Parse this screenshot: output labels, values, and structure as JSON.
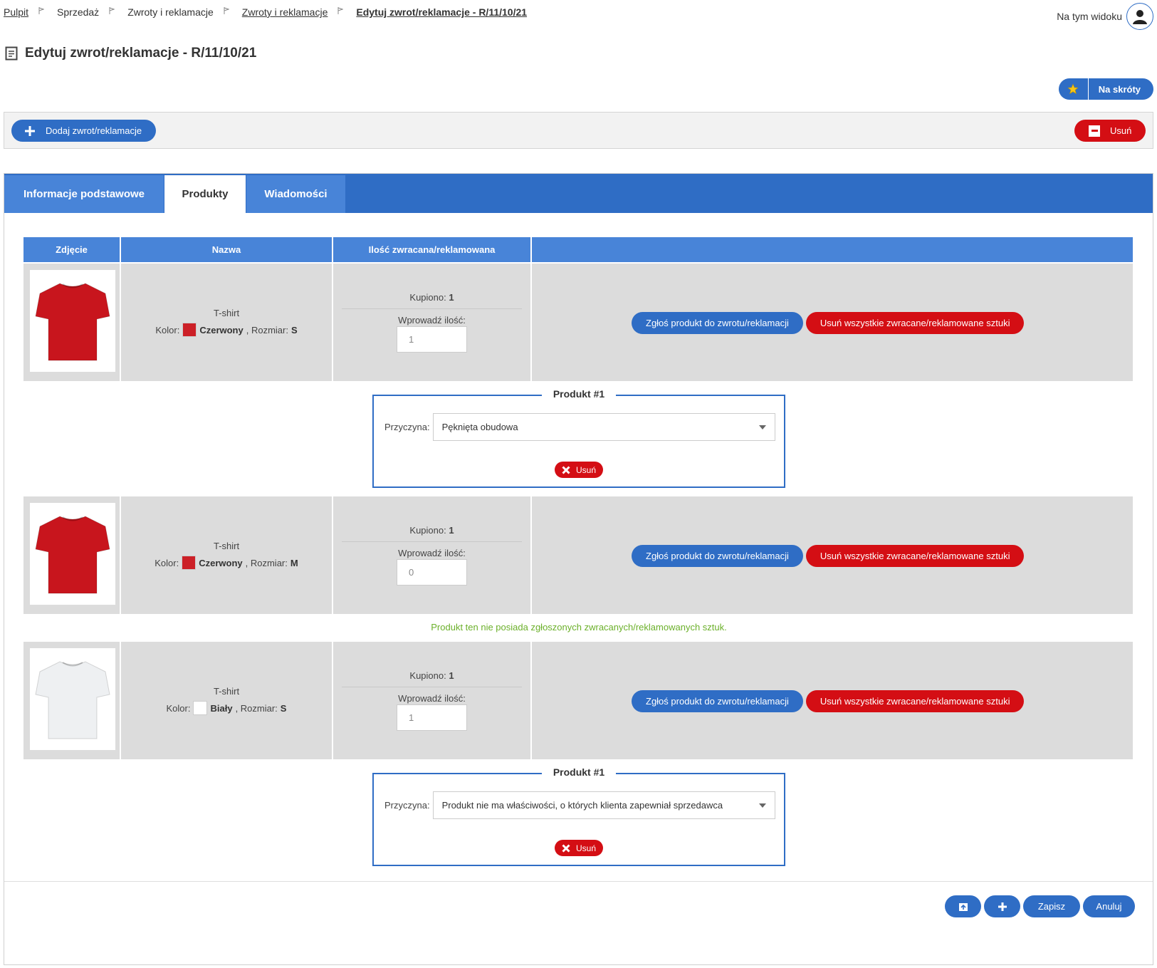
{
  "breadcrumb": {
    "items": [
      {
        "label": "Pulpit",
        "style": "link"
      },
      {
        "label": "Sprzedaż",
        "style": "plain"
      },
      {
        "label": "Zwroty i reklamacje",
        "style": "plain"
      },
      {
        "label": "Zwroty i reklamacje",
        "style": "link"
      },
      {
        "label": "Edytuj zwrot/reklamacje - R/11/10/21",
        "style": "current"
      }
    ]
  },
  "header": {
    "view_label": "Na tym widoku",
    "title": "Edytuj zwrot/reklamacje - R/11/10/21",
    "shortcut_label": "Na skróty"
  },
  "actionbar": {
    "add_label": "Dodaj zwrot/reklamacje",
    "delete_label": "Usuń"
  },
  "tabs": [
    {
      "label": "Informacje podstawowe",
      "active": false
    },
    {
      "label": "Produkty",
      "active": true
    },
    {
      "label": "Wiadomości",
      "active": false
    }
  ],
  "table": {
    "columns": [
      "Zdjęcie",
      "Nazwa",
      "Ilość zwracana/reklamowana",
      ""
    ],
    "labels": {
      "color": "Kolor:",
      "size": ", Rozmiar:",
      "bought": "Kupiono:",
      "enter_qty": "Wprowadź ilość:",
      "report_btn": "Zgłoś produkt do zwrotu/reklamacji",
      "remove_all_btn": "Usuń wszystkie zwracane/reklamowane sztuki",
      "reason": "Przyczyna:",
      "reason_delete": "Usuń"
    },
    "rows": [
      {
        "name": "T-shirt",
        "color": "Czerwony",
        "swatch": "#cc2027",
        "shirt": "#c8151d",
        "size": "S",
        "bought": "1",
        "qty": "1",
        "reason_box": {
          "title": "Produkt #1",
          "reason": "Pęknięta obudowa"
        }
      },
      {
        "name": "T-shirt",
        "color": "Czerwony",
        "swatch": "#cc2027",
        "shirt": "#c8151d",
        "size": "M",
        "bought": "1",
        "qty": "0",
        "empty_note": "Produkt ten nie posiada zgłoszonych zwracanych/reklamowanych sztuk."
      },
      {
        "name": "T-shirt",
        "color": "Biały",
        "swatch": "#ffffff",
        "shirt": "#eef0f2",
        "size": "S",
        "bought": "1",
        "qty": "1",
        "reason_box": {
          "title": "Produkt #1",
          "reason": "Produkt nie ma właściwości, o których klienta zapewniał sprzedawca"
        }
      }
    ]
  },
  "footer": {
    "save_label": "Zapisz",
    "cancel_label": "Anuluj"
  },
  "colors": {
    "primary": "#2f6dc5",
    "danger": "#d40e14",
    "success_text": "#6bb02a"
  }
}
